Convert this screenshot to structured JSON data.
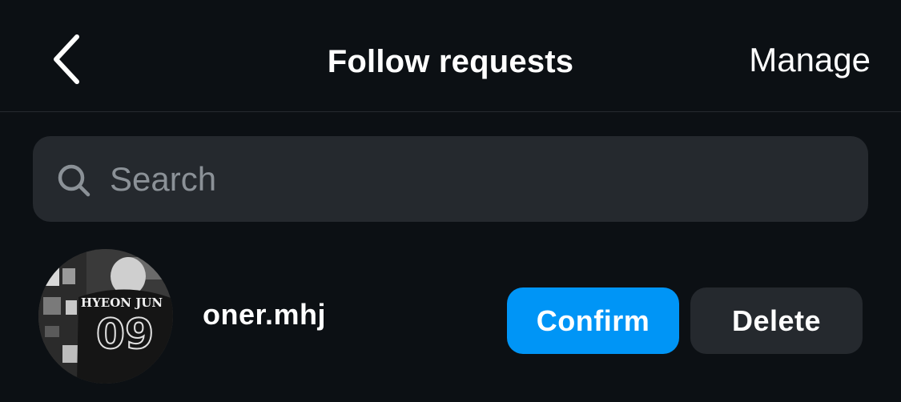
{
  "header": {
    "title": "Follow requests",
    "manage_label": "Manage",
    "back_icon": "chevron-left-icon"
  },
  "search": {
    "placeholder": "Search",
    "value": "",
    "icon": "search-icon"
  },
  "requests": [
    {
      "username": "oner.mhj",
      "avatar_jersey_name": "HYEON JUN",
      "avatar_jersey_number": "09",
      "confirm_label": "Confirm",
      "delete_label": "Delete"
    }
  ],
  "colors": {
    "background": "#0c1014",
    "search_bg": "#25292e",
    "confirm_bg": "#0095f6",
    "delete_bg": "#25292e",
    "placeholder": "#8b9197"
  }
}
